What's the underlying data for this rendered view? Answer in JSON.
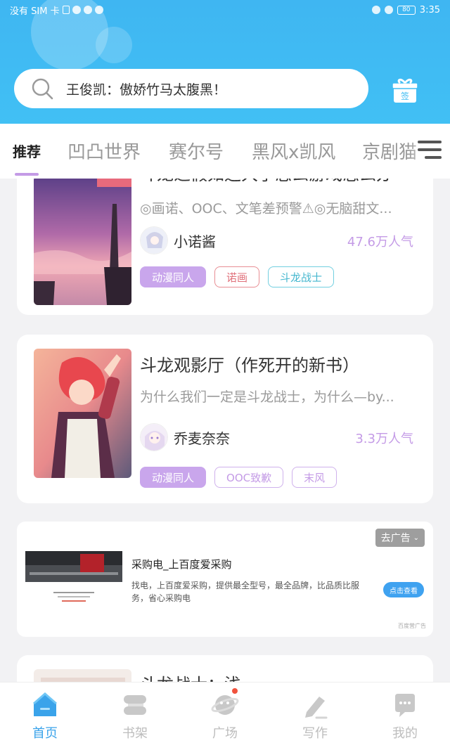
{
  "status_bar": {
    "left_text": "没有 SIM 卡",
    "time": "3:35",
    "battery": "80"
  },
  "search": {
    "placeholder": "王俊凯：傲娇竹马太腹黑！"
  },
  "gift": {
    "label": "签"
  },
  "tabs": [
    {
      "label": "推荐",
      "active": true
    },
    {
      "label": "凹凸世界"
    },
    {
      "label": "赛尔号"
    },
    {
      "label": "黑风x凯风"
    },
    {
      "label": "京剧猫"
    }
  ],
  "books": [
    {
      "title": "斗龙之假如运大了怎么游戏怎么办",
      "desc": "◎画诺、OOC、文笔差预警⚠◎无脑甜文...",
      "author": "小诺酱",
      "popularity": "47.6万人气",
      "tags": [
        {
          "label": "动漫同人",
          "style": "purple"
        },
        {
          "label": "诺画",
          "style": "red"
        },
        {
          "label": "斗龙战士",
          "style": "cyan"
        }
      ]
    },
    {
      "title": "斗龙观影厅（作死开的新书）",
      "desc": "为什么我们一定是斗龙战士，为什么—by...",
      "author": "乔麦奈奈",
      "popularity": "3.3万人气",
      "tags": [
        {
          "label": "动漫同人",
          "style": "purple"
        },
        {
          "label": "OOC致歉",
          "style": "violet"
        },
        {
          "label": "末风",
          "style": "violet"
        }
      ]
    },
    {
      "title": "斗龙战士：浅",
      "desc": "",
      "author": "",
      "popularity": "",
      "tags": []
    }
  ],
  "ad": {
    "close_label": "去广告",
    "title": "采购电_上百度爱采购",
    "desc": "找电，上百度爱采购，提供最全型号，最全品牌，比品质比服务，省心采购电",
    "button": "点击查看",
    "source": "百度营广告"
  },
  "bottom_nav": [
    {
      "label": "首页",
      "icon": "home-icon",
      "active": true
    },
    {
      "label": "书架",
      "icon": "bookshelf-icon"
    },
    {
      "label": "广场",
      "icon": "planet-icon",
      "badge": true
    },
    {
      "label": "写作",
      "icon": "pen-icon"
    },
    {
      "label": "我的",
      "icon": "chat-bubble-icon"
    }
  ],
  "colors": {
    "header": "#3fb6f2",
    "accent_purple": "#c49be6",
    "active_nav": "#3aa3ea"
  }
}
